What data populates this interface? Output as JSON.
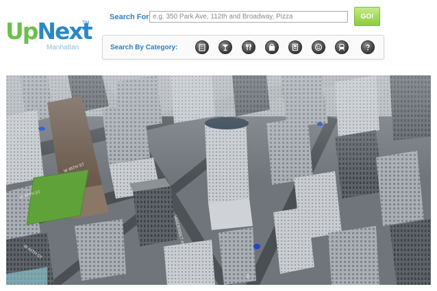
{
  "logo": {
    "main_up": "Up",
    "main_next": "Next",
    "trademark": "TM",
    "subtitle": "Manhattan"
  },
  "search": {
    "label": "Search For:",
    "placeholder": "e.g. 350 Park Ave, 112th and Broadway, Pizza",
    "value": "",
    "go_label": "GO!"
  },
  "categories": {
    "label": "Search By Category:",
    "items": [
      {
        "icon": "building-icon"
      },
      {
        "icon": "cocktail-icon"
      },
      {
        "icon": "restaurant-icon"
      },
      {
        "icon": "shopping-bag-icon"
      },
      {
        "icon": "atm-icon"
      },
      {
        "icon": "smiley-icon"
      },
      {
        "icon": "subway-icon"
      },
      {
        "icon": "help-icon"
      }
    ]
  },
  "map": {
    "street_labels": [
      "W 45TH ST",
      "W 46TH ST",
      "W 44TH ST",
      "VANDERBILT AV",
      "AV"
    ]
  },
  "colors": {
    "brand_green": "#6cc04a",
    "brand_blue": "#2b88c8",
    "label_blue": "#2b7fc1",
    "go_green": "#8ccb3e"
  }
}
